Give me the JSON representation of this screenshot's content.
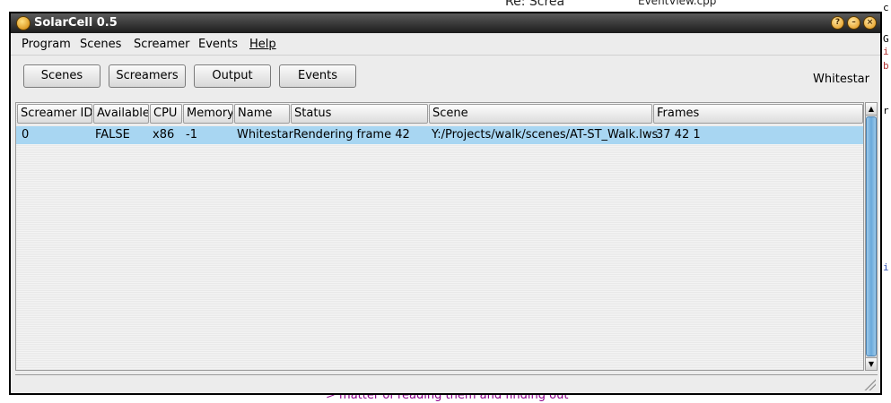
{
  "background": {
    "bottom_text": "> matter of reading them and finding out",
    "top_fragment": "Re: Screa",
    "top_file": "EventView.cpp",
    "right_letters": [
      "c",
      "G",
      "i",
      "b",
      "r",
      "i"
    ]
  },
  "window": {
    "title": "SolarCell 0.5",
    "buttons": [
      "help",
      "minimize",
      "close"
    ]
  },
  "menubar": {
    "items": [
      "Program",
      "Scenes",
      "Screamer",
      "Events",
      "Help"
    ]
  },
  "toolbar": {
    "buttons": [
      "Scenes",
      "Screamers",
      "Output",
      "Events"
    ],
    "host": "Whitestar"
  },
  "table": {
    "columns": [
      "Screamer ID",
      "Available",
      "CPU",
      "Memory",
      "Name",
      "Status",
      "Scene",
      "Frames"
    ],
    "rows": [
      {
        "screamer_id": "0",
        "available": "FALSE",
        "cpu": "x86",
        "memory": "-1",
        "name": "Whitestar",
        "status": "Rendering frame 42",
        "scene": "Y:/Projects/walk/scenes/AT-ST_Walk.lws",
        "frames": "37 42 1"
      }
    ]
  },
  "colors": {
    "selection": "#a8d6f2",
    "titlebar": "#1c1c1c",
    "scroll_thumb": "#6aa9da"
  }
}
